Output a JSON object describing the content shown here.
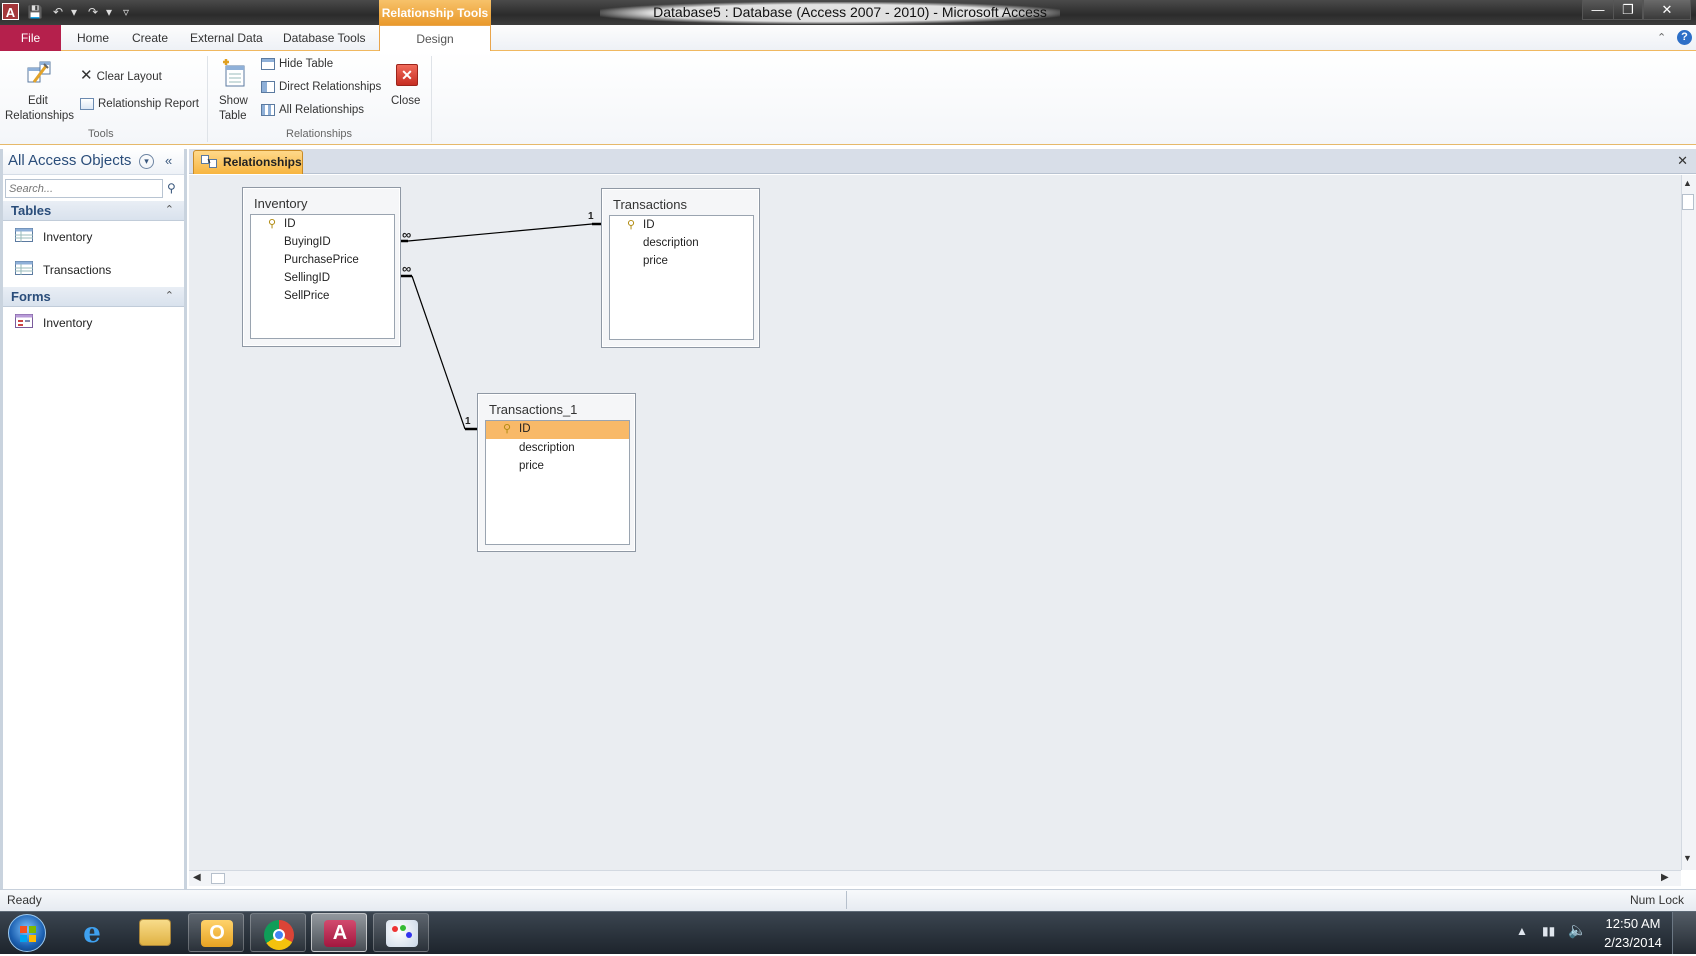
{
  "app": {
    "window_title": "Database5 : Database (Access 2007 - 2010)  -  Microsoft Access",
    "context_tab_group": "Relationship Tools",
    "icon_letter": "A"
  },
  "ribbon": {
    "tabs": [
      "File",
      "Home",
      "Create",
      "External Data",
      "Database Tools",
      "Design"
    ],
    "groups": {
      "tools": {
        "label": "Tools",
        "edit_relationships": "Edit Relationships",
        "edit_line1": "Edit",
        "edit_line2": "Relationships",
        "clear_layout": "Clear Layout",
        "relationship_report": "Relationship Report"
      },
      "relationships": {
        "label": "Relationships",
        "show_table_line1": "Show",
        "show_table_line2": "Table",
        "hide_table": "Hide Table",
        "direct_relationships": "Direct Relationships",
        "all_relationships": "All Relationships",
        "close": "Close"
      }
    }
  },
  "nav": {
    "title": "All Access Objects",
    "search_placeholder": "Search...",
    "sections": [
      {
        "label": "Tables",
        "items": [
          "Inventory",
          "Transactions"
        ]
      },
      {
        "label": "Forms",
        "items": [
          "Inventory"
        ]
      }
    ]
  },
  "document": {
    "tab_label": "Relationships"
  },
  "diagram": {
    "tables": [
      {
        "name": "Inventory",
        "fields": [
          "ID",
          "BuyingID",
          "PurchasePrice",
          "SellingID",
          "SellPrice"
        ],
        "key_field": "ID"
      },
      {
        "name": "Transactions",
        "fields": [
          "ID",
          "description",
          "price"
        ],
        "key_field": "ID"
      },
      {
        "name": "Transactions_1",
        "fields": [
          "ID",
          "description",
          "price"
        ],
        "key_field": "ID",
        "selected_field": "ID"
      }
    ],
    "relationships": [
      {
        "from": "Inventory.BuyingID",
        "to": "Transactions.ID",
        "from_card": "∞",
        "to_card": "1"
      },
      {
        "from": "Inventory.SellingID",
        "to": "Transactions_1.ID",
        "from_card": "∞",
        "to_card": "1"
      }
    ]
  },
  "status": {
    "left": "Ready",
    "right": "Num Lock"
  },
  "taskbar": {
    "time": "12:50 AM",
    "date": "2/23/2014"
  }
}
